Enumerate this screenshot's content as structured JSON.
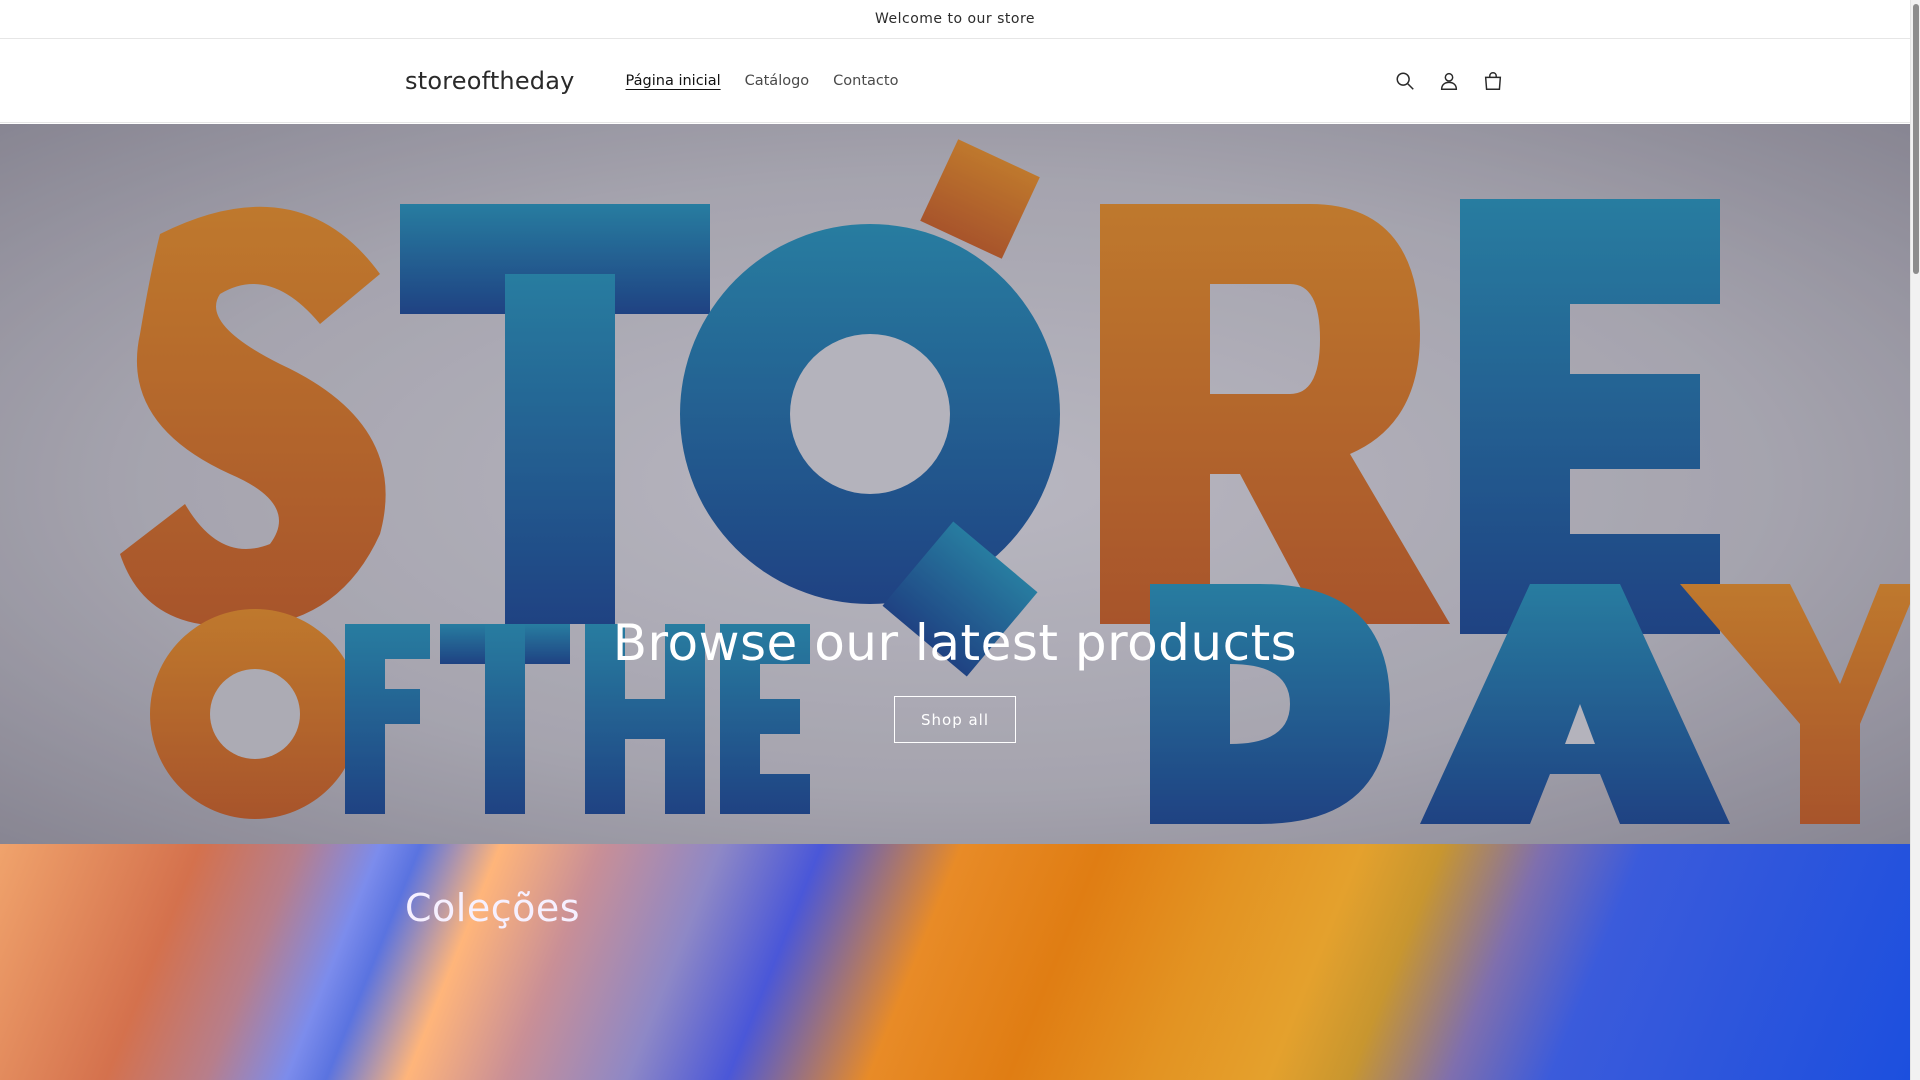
{
  "announcement": {
    "text": "Welcome to our store"
  },
  "header": {
    "logo": "storeoftheday",
    "nav": [
      {
        "label": "Página inicial",
        "active": true
      },
      {
        "label": "Catálogo",
        "active": false
      },
      {
        "label": "Contacto",
        "active": false
      }
    ],
    "icons": [
      "search-icon",
      "account-icon",
      "cart-icon"
    ]
  },
  "hero": {
    "title": "Browse our latest products",
    "button_label": "Shop all",
    "background_letters_top": "STORE",
    "background_letters_bottom": "OF THE DAY"
  },
  "collections": {
    "title": "Coleções"
  },
  "colors": {
    "accent_orange": "#e68a2e",
    "accent_blue": "#2f7fb8",
    "collections_blue": "#1c4fde"
  }
}
